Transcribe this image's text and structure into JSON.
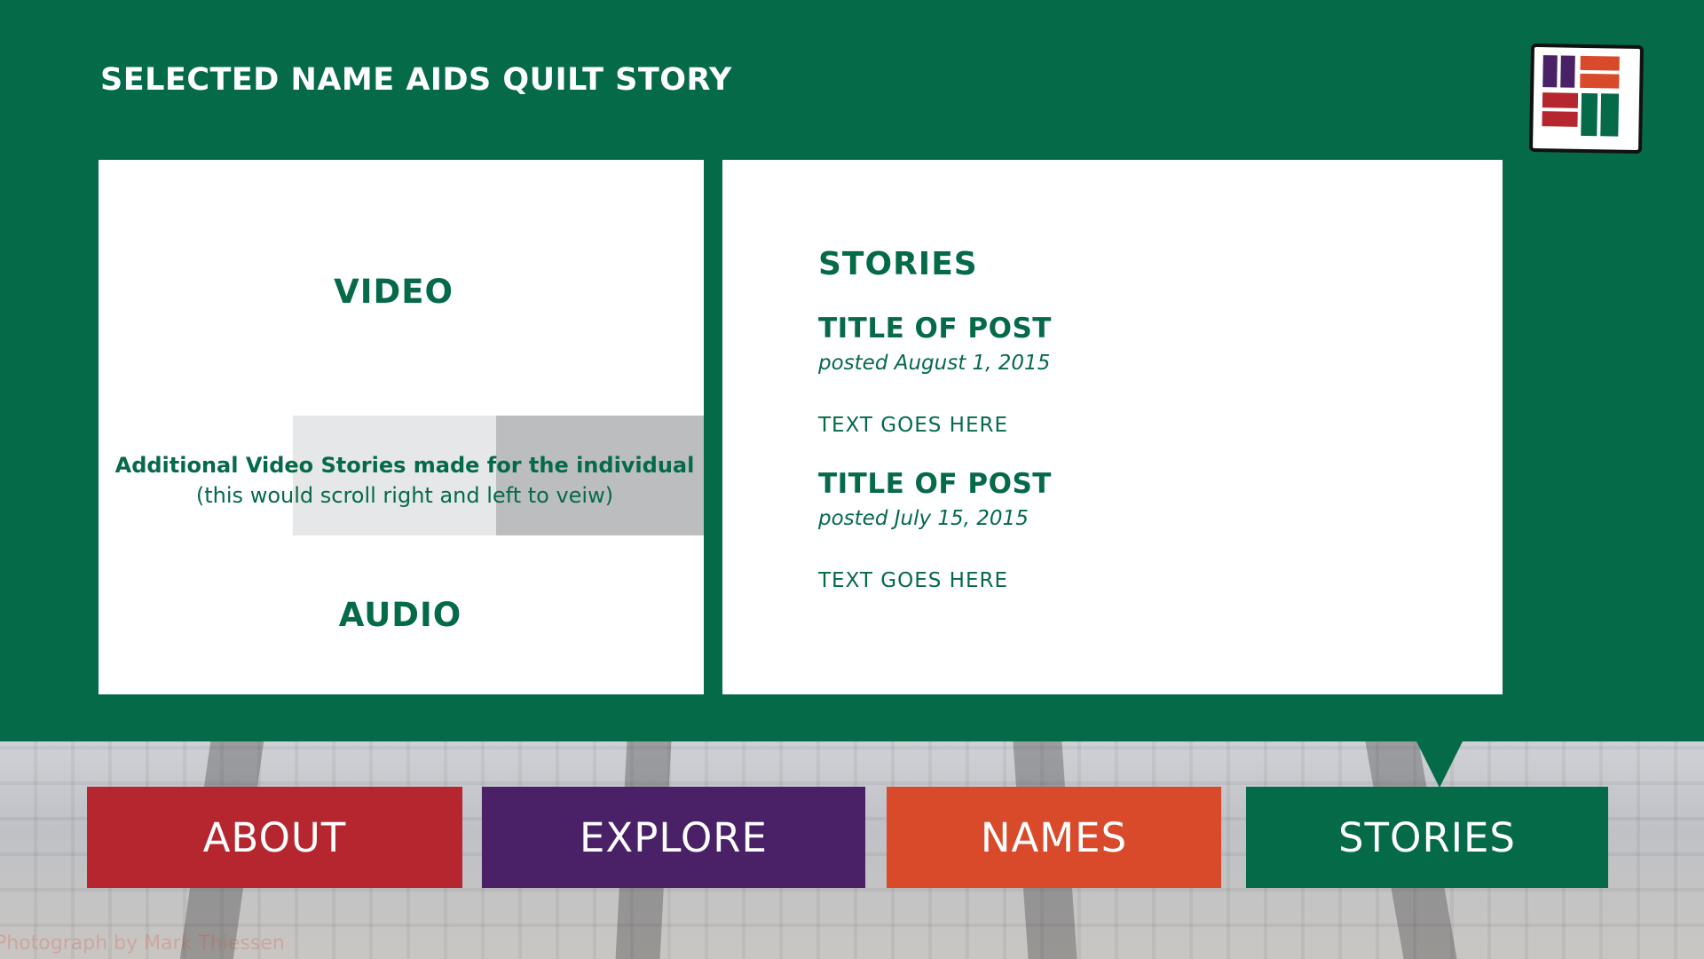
{
  "page": {
    "title": "SELECTED NAME AIDS QUILT STORY"
  },
  "colors": {
    "brand_green": "#056a48",
    "about_red": "#b5262e",
    "explore_purple": "#4a2166",
    "names_orange": "#d84a2a",
    "stories_green": "#056a48"
  },
  "logo": {
    "icon": "quilt-logo-icon"
  },
  "media": {
    "video_label": "VIDEO",
    "scroll_caption_line1": "Additional Video Stories made for the individual",
    "scroll_caption_line2": "(this would scroll right and left to veiw)",
    "audio_label": "AUDIO"
  },
  "stories": {
    "heading": "STORIES",
    "posts": [
      {
        "title": "TITLE OF POST",
        "date": "posted August 1, 2015",
        "body": "TEXT GOES HERE"
      },
      {
        "title": "TITLE OF POST",
        "date": "posted July 15, 2015",
        "body": "TEXT GOES HERE"
      }
    ]
  },
  "photo": {
    "credit": "Photograph by Mark Thiessen"
  },
  "nav": {
    "about": "ABOUT",
    "explore": "EXPLORE",
    "names": "NAMES",
    "stories": "STORIES",
    "active": "STORIES"
  }
}
